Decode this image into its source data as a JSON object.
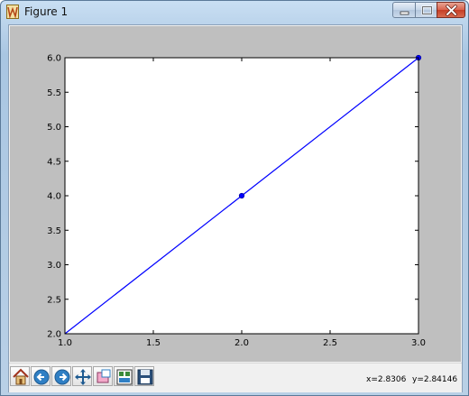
{
  "window": {
    "title": "Figure 1",
    "minimize_icon": "minimize-icon",
    "maximize_icon": "maximize-icon",
    "close_icon": "close-icon"
  },
  "toolbar": {
    "buttons": [
      {
        "name": "home-button",
        "icon": "home-icon"
      },
      {
        "name": "back-button",
        "icon": "back-arrow-icon"
      },
      {
        "name": "forward-button",
        "icon": "forward-arrow-icon"
      },
      {
        "name": "pan-button",
        "icon": "pan-icon"
      },
      {
        "name": "zoom-button",
        "icon": "zoom-rect-icon"
      },
      {
        "name": "subplots-button",
        "icon": "subplots-icon"
      },
      {
        "name": "save-button",
        "icon": "save-icon"
      }
    ],
    "x_readout": "x=2.8306",
    "y_readout": "y=2.84146"
  },
  "chart_data": {
    "type": "line",
    "x": [
      1.0,
      2.0,
      3.0
    ],
    "series": [
      {
        "values": [
          2.0,
          4.0,
          6.0
        ],
        "color": "#0000ff"
      }
    ],
    "markers": [
      {
        "x": 2.0,
        "y": 4.0
      },
      {
        "x": 3.0,
        "y": 6.0
      }
    ],
    "xlim": [
      1.0,
      3.0
    ],
    "ylim": [
      2.0,
      6.0
    ],
    "xticks": [
      "1.0",
      "1.5",
      "2.0",
      "2.5",
      "3.0"
    ],
    "yticks": [
      "2.0",
      "2.5",
      "3.0",
      "3.5",
      "4.0",
      "4.5",
      "5.0",
      "5.5",
      "6.0"
    ],
    "title": "",
    "xlabel": "",
    "ylabel": "",
    "grid": false,
    "plot_background": "#ffffff",
    "figure_background": "#bfbfbf"
  }
}
